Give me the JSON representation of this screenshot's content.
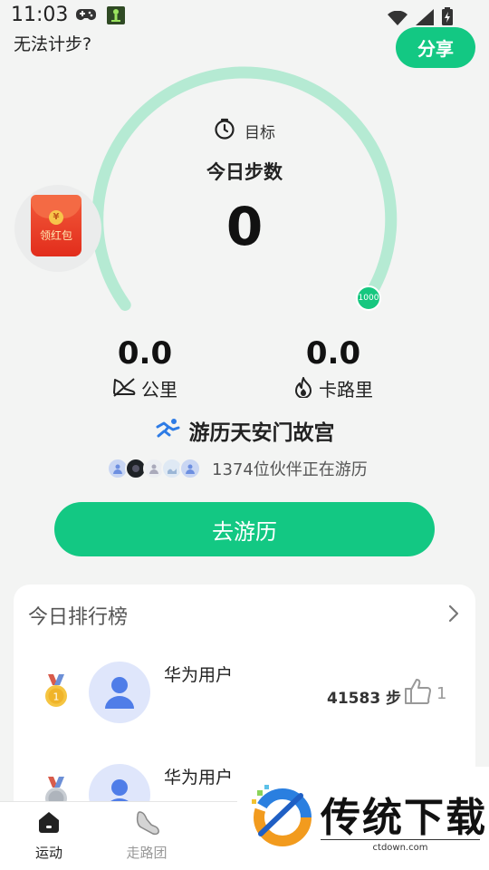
{
  "status_bar": {
    "time": "11:03"
  },
  "header": {
    "cannot_count": "无法计步?",
    "share_label": "分享"
  },
  "gauge": {
    "target_label": "目标",
    "steps_title": "今日步数",
    "steps_value": "0",
    "goal": "1000",
    "progress": 0
  },
  "red_packet": {
    "label": "领红包"
  },
  "stats": {
    "distance_value": "0.0",
    "distance_label": "公里",
    "calories_value": "0.0",
    "calories_label": "卡路里"
  },
  "tour": {
    "title": "游历天安门故宫",
    "partners_text": "1374位伙伴正在游历",
    "go_label": "去游历"
  },
  "ranking": {
    "title": "今日排行榜",
    "rows": [
      {
        "name": "华为用户",
        "steps": "41583 步",
        "likes": "1"
      },
      {
        "name": "华为用户"
      }
    ]
  },
  "tabs": [
    {
      "label": "运动",
      "active": true
    },
    {
      "label": "走路团",
      "active": false
    }
  ],
  "watermark": {
    "text": "传统下载",
    "url": "ctdown.com"
  },
  "colors": {
    "accent": "#13c883",
    "arc": "#b5ead3",
    "active_tab": "#222222",
    "inactive_tab": "#999999"
  }
}
